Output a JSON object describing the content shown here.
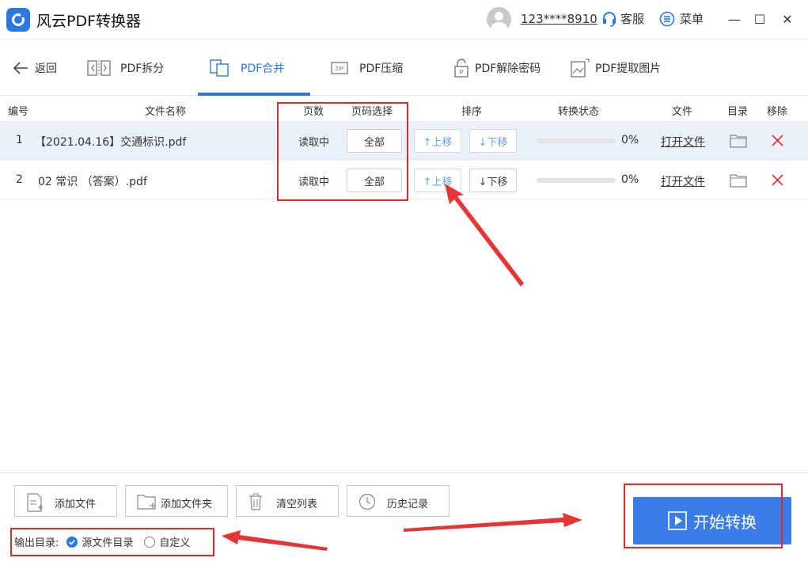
{
  "app": {
    "title": "风云PDF转换器"
  },
  "header": {
    "user_phone": "123****8910",
    "service_label": "客服",
    "menu_label": "菜单",
    "minimize": "—",
    "maximize": "☐",
    "close": "✕"
  },
  "nav": {
    "back_label": "返回",
    "tabs": [
      {
        "label": "PDF拆分",
        "icon": "split-icon"
      },
      {
        "label": "PDF合并",
        "icon": "merge-icon",
        "active": true
      },
      {
        "label": "PDF压缩",
        "icon": "zip-icon"
      },
      {
        "label": "PDF解除密码",
        "icon": "lock-icon"
      },
      {
        "label": "PDF提取图片",
        "icon": "image-icon"
      }
    ]
  },
  "table": {
    "headers": [
      "编号",
      "文件名称",
      "页数",
      "页码选择",
      "排序",
      "转换状态",
      "文件",
      "目录",
      "移除"
    ],
    "rows": [
      {
        "index": "1",
        "name": "【2021.04.16】交通标识.pdf",
        "pages": "读取中",
        "page_select": "全部",
        "move_up": "↑上移",
        "move_down": "↓下移",
        "progress": 0,
        "progress_text": "0%",
        "open_file": "打开文件",
        "selected": true
      },
      {
        "index": "2",
        "name": "02 常识 （答案）.pdf",
        "pages": "读取中",
        "page_select": "全部",
        "move_up": "↑上移",
        "move_down": "↓下移",
        "progress": 0,
        "progress_text": "0%",
        "open_file": "打开文件",
        "selected": false
      }
    ]
  },
  "toolbar": {
    "add_file": "添加文件",
    "add_folder": "添加文件夹",
    "clear_list": "清空列表",
    "history": "历史记录"
  },
  "output": {
    "label": "输出目录:",
    "option_source": "源文件目录",
    "option_custom": "自定义",
    "selected": "源文件目录"
  },
  "start_button": "开始转换",
  "colors": {
    "accent": "#2a79e2",
    "button": "#3b7de6",
    "annotation": "#e02a2a",
    "delete": "#e0353a"
  }
}
